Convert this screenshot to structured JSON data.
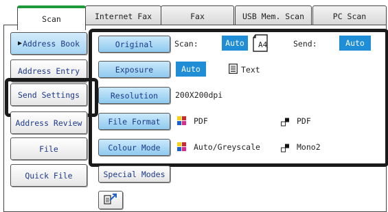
{
  "tabs": [
    "Scan",
    "Internet Fax",
    "Fax",
    "USB Mem. Scan",
    "PC Scan"
  ],
  "left_nav": {
    "address_book": "Address Book",
    "address_entry": "Address Entry",
    "send_settings": "Send Settings",
    "address_review": "Address Review",
    "file": "File",
    "quick_file": "Quick File"
  },
  "settings": {
    "original": {
      "button": "Original",
      "scan_label": "Scan:",
      "scan_value": "Auto",
      "paper": "A4",
      "send_label": "Send:",
      "send_value": "Auto"
    },
    "exposure": {
      "button": "Exposure",
      "value": "Auto",
      "text_label": "Text"
    },
    "resolution": {
      "button": "Resolution",
      "value": "200X200dpi"
    },
    "file_format": {
      "button": "File Format",
      "colour": "PDF",
      "mono": "PDF"
    },
    "colour_mode": {
      "button": "Colour Mode",
      "colour": "Auto/Greyscale",
      "mono": "Mono2"
    },
    "special_modes": {
      "button": "Special Modes"
    }
  },
  "colors": {
    "accent": "#1f8ed6",
    "active_tab_stripe": "#1f9a3a",
    "button_blue": "#a6d4f2",
    "highlight": "#1a1a1a"
  },
  "icons": {
    "page": "paper-a4-icon",
    "text": "text-document-icon",
    "colour_square": "colour-quad-icon",
    "mono": "mono-squares-icon",
    "transfer": "program-transfer-icon"
  }
}
